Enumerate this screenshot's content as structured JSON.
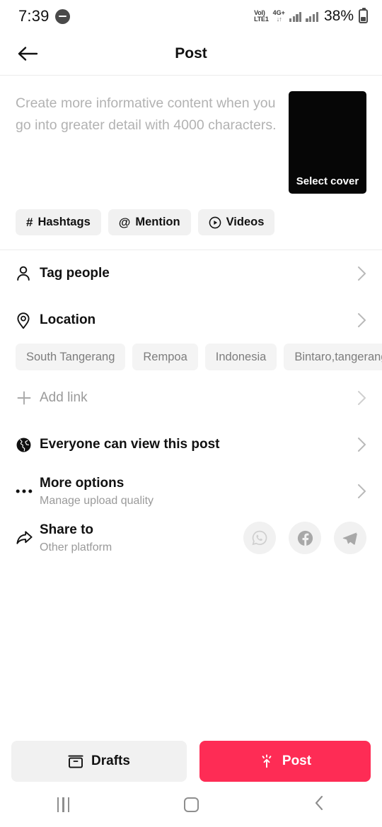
{
  "status_bar": {
    "time": "7:39",
    "dnd_icon": "do-not-disturb-icon",
    "volte_line1": "VoI)",
    "volte_line2": "LTE1",
    "network_type": "4G+",
    "data_arrows": "↓↑",
    "battery_percent": "38%"
  },
  "header": {
    "title": "Post",
    "back_label": "Back"
  },
  "composer": {
    "caption_placeholder": "Create more informative content when you go into greater detail with 4000 characters.",
    "cover_label": "Select cover",
    "chips": [
      {
        "glyph": "#",
        "label": "Hashtags",
        "name": "hashtags-chip"
      },
      {
        "glyph": "@",
        "label": "Mention",
        "name": "mention-chip"
      },
      {
        "glyph": "play",
        "label": "Videos",
        "name": "videos-chip"
      }
    ]
  },
  "options": {
    "tag_people": {
      "title": "Tag people"
    },
    "location": {
      "title": "Location",
      "suggestions": [
        "South Tangerang",
        "Rempoa",
        "Indonesia",
        "Bintaro,tangerang"
      ]
    },
    "add_link": {
      "title": "Add link"
    },
    "privacy": {
      "title": "Everyone can view this post"
    },
    "more_options": {
      "title": "More options",
      "subtitle": "Manage upload quality"
    },
    "share_to": {
      "title": "Share to",
      "subtitle": "Other platform",
      "platforms": [
        "whatsapp",
        "facebook",
        "telegram"
      ]
    }
  },
  "bottom": {
    "drafts_label": "Drafts",
    "post_label": "Post",
    "post_color": "#fe2c55"
  }
}
